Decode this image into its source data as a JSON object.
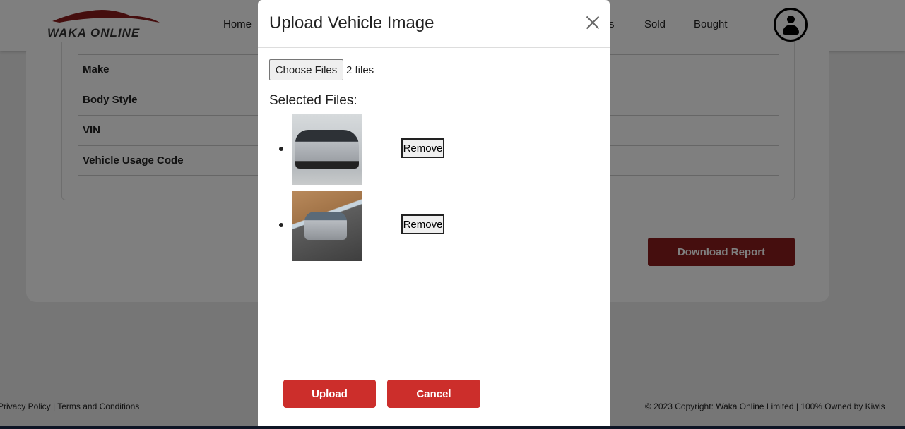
{
  "header": {
    "logo_text": "WAKA ONLINE",
    "nav": [
      "Home",
      "s",
      "Sold",
      "Bought"
    ]
  },
  "details": {
    "rows": [
      "Make",
      "Body Style",
      "VIN",
      "Vehicle Usage Code"
    ],
    "download_label": "Download Report"
  },
  "footer": {
    "left": "Privacy Policy | Terms and Conditions",
    "right": "© 2023 Copyright: Waka Online Limited | 100% Owned by Kiwis"
  },
  "modal": {
    "title": "Upload Vehicle Image",
    "choose_label": "Choose Files",
    "files_status": "2 files",
    "selected_label": "Selected Files:",
    "files": [
      {
        "remove_label": "Remove"
      },
      {
        "remove_label": "Remove"
      }
    ],
    "upload_label": "Upload",
    "cancel_label": "Cancel"
  },
  "colors": {
    "accent": "#cc2e2b",
    "download": "#8b1c1c"
  }
}
